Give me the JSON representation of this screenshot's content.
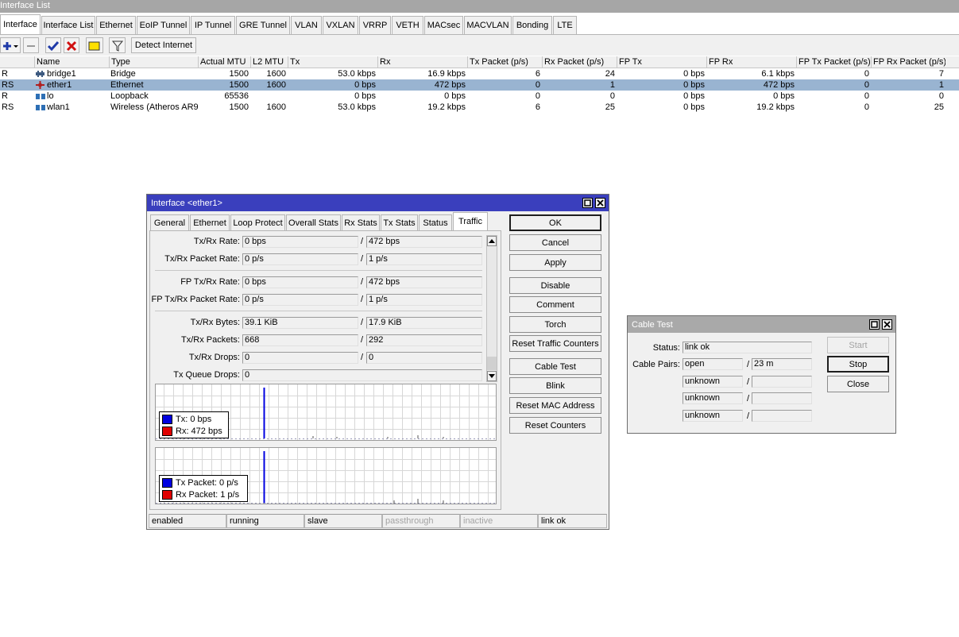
{
  "window_title": "Interface List",
  "tabs": [
    "Interface",
    "Interface List",
    "Ethernet",
    "EoIP Tunnel",
    "IP Tunnel",
    "GRE Tunnel",
    "VLAN",
    "VXLAN",
    "VRRP",
    "VETH",
    "MACsec",
    "MACVLAN",
    "Bonding",
    "LTE"
  ],
  "toolbar": {
    "add_icon": "plus-icon",
    "remove_icon": "minus-icon",
    "enable_icon": "check-icon",
    "disable_icon": "x-icon",
    "comment_icon": "note-icon",
    "filter_icon": "filter-icon",
    "detect_label": "Detect Internet"
  },
  "columns": [
    "Name",
    "Type",
    "Actual MTU",
    "L2 MTU",
    "Tx",
    "Rx",
    "Tx Packet (p/s)",
    "Rx Packet (p/s)",
    "FP Tx",
    "FP Rx",
    "FP Tx Packet (p/s)",
    "FP Rx Packet (p/s)"
  ],
  "rows": [
    {
      "flags": "R",
      "icon": "bridge-icon",
      "name": "bridge1",
      "type": "Bridge",
      "mtu": "1500",
      "l2mtu": "1600",
      "tx": "53.0 kbps",
      "rx": "16.9 kbps",
      "txp": "6",
      "rxp": "24",
      "fptx": "0 bps",
      "fprx": "6.1 kbps",
      "fptxp": "0",
      "fprxp": "7"
    },
    {
      "flags": "RS",
      "icon": "ethernet-icon",
      "name": "ether1",
      "type": "Ethernet",
      "mtu": "1500",
      "l2mtu": "1600",
      "tx": "0 bps",
      "rx": "472 bps",
      "txp": "0",
      "rxp": "1",
      "fptx": "0 bps",
      "fprx": "472 bps",
      "fptxp": "0",
      "fprxp": "1"
    },
    {
      "flags": "R",
      "icon": "loopback-icon",
      "name": "lo",
      "type": "Loopback",
      "mtu": "65536",
      "l2mtu": "",
      "tx": "0 bps",
      "rx": "0 bps",
      "txp": "0",
      "rxp": "0",
      "fptx": "0 bps",
      "fprx": "0 bps",
      "fptxp": "0",
      "fprxp": "0"
    },
    {
      "flags": "RS",
      "icon": "wireless-icon",
      "name": "wlan1",
      "type": "Wireless (Atheros AR9...",
      "mtu": "1500",
      "l2mtu": "1600",
      "tx": "53.0 kbps",
      "rx": "19.2 kbps",
      "txp": "6",
      "rxp": "25",
      "fptx": "0 bps",
      "fprx": "19.2 kbps",
      "fptxp": "0",
      "fprxp": "25"
    }
  ],
  "iface": {
    "title": "Interface <ether1>",
    "tabs": [
      "General",
      "Ethernet",
      "Loop Protect",
      "Overall Stats",
      "Rx Stats",
      "Tx Stats",
      "Status",
      "Traffic"
    ],
    "fields": [
      {
        "label": "Tx/Rx Rate:",
        "a": "0 bps",
        "b": "472 bps"
      },
      {
        "label": "Tx/Rx Packet Rate:",
        "a": "0 p/s",
        "b": "1 p/s"
      },
      {
        "label": "FP Tx/Rx Rate:",
        "a": "0 bps",
        "b": "472 bps"
      },
      {
        "label": "FP Tx/Rx Packet Rate:",
        "a": "0 p/s",
        "b": "1 p/s"
      },
      {
        "label": "Tx/Rx Bytes:",
        "a": "39.1 KiB",
        "b": "17.9 KiB"
      },
      {
        "label": "Tx/Rx Packets:",
        "a": "668",
        "b": "292"
      },
      {
        "label": "Tx/Rx Drops:",
        "a": "0",
        "b": "0"
      },
      {
        "label": "Tx Queue Drops:",
        "a": "0"
      }
    ],
    "graph1_legend": {
      "tx": "Tx:  0 bps",
      "rx": "Rx:  472 bps"
    },
    "graph2_legend": {
      "tx": "Tx Packet:  0 p/s",
      "rx": "Rx Packet:  1 p/s"
    },
    "buttons": [
      "OK",
      "Cancel",
      "Apply",
      "Disable",
      "Comment",
      "Torch",
      "Reset Traffic Counters",
      "Cable Test",
      "Blink",
      "Reset MAC Address",
      "Reset Counters"
    ],
    "status_bar": [
      "enabled",
      "running",
      "slave",
      "passthrough",
      "inactive",
      "link ok"
    ]
  },
  "cable": {
    "title": "Cable Test",
    "status_label": "Status:",
    "status": "link ok",
    "pairs_label": "Cable Pairs:",
    "pairs": [
      {
        "a": "open",
        "b": "23 m"
      },
      {
        "a": "unknown",
        "b": ""
      },
      {
        "a": "unknown",
        "b": ""
      },
      {
        "a": "unknown",
        "b": ""
      }
    ],
    "buttons": [
      "Start",
      "Stop",
      "Close"
    ]
  },
  "colors": {
    "tx": "#0000e0",
    "rx": "#e00000",
    "selected_row": "#99b4d1",
    "active_title": "#3a3fbd"
  }
}
